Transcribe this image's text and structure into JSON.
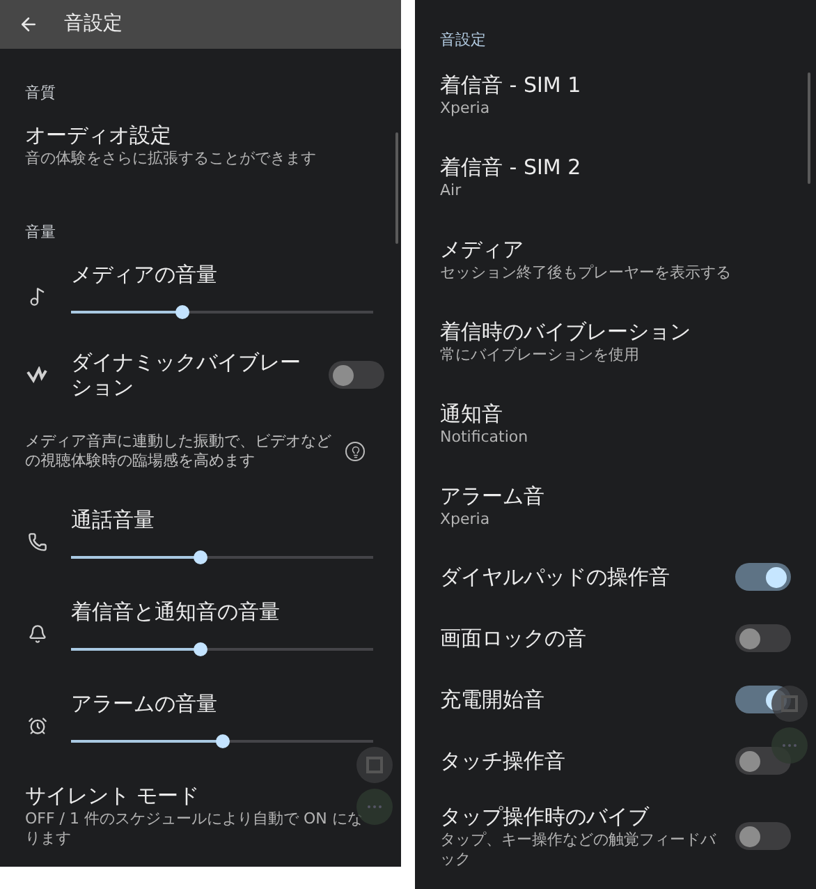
{
  "left": {
    "header": {
      "title": "音設定"
    },
    "items": [
      {
        "kind": "section",
        "title": "音質"
      },
      {
        "kind": "link",
        "title": "オーディオ設定",
        "subtitle": "音の体験をさらに拡張することができます"
      },
      {
        "kind": "section",
        "title": "音量"
      },
      {
        "kind": "slider",
        "title": "メディアの音量",
        "level": 0.37
      },
      {
        "kind": "toggle",
        "title": "ダイナミックバイブレーション",
        "on": false
      },
      {
        "kind": "note",
        "text": "メディア音声に連動した振動で、ビデオなどの視聴体験時の臨場感を高めます"
      },
      {
        "kind": "slider",
        "title": "通話音量",
        "level": 0.43
      },
      {
        "kind": "slider",
        "title": "着信音と通知音の音量",
        "level": 0.43
      },
      {
        "kind": "slider",
        "title": "アラームの音量",
        "level": 0.5
      },
      {
        "kind": "link",
        "title": "サイレント モード",
        "subtitle": "OFF / 1 件のスケジュールにより自動で ON になります"
      }
    ]
  },
  "right": {
    "items": [
      {
        "kind": "section",
        "title": "音設定"
      },
      {
        "kind": "link",
        "title": "着信音 - SIM 1",
        "subtitle": "Xperia"
      },
      {
        "kind": "link",
        "title": "着信音 - SIM 2",
        "subtitle": "Air"
      },
      {
        "kind": "link",
        "title": "メディア",
        "subtitle": "セッション終了後もプレーヤーを表示する"
      },
      {
        "kind": "link",
        "title": "着信時のバイブレーション",
        "subtitle": "常にバイブレーションを使用"
      },
      {
        "kind": "link",
        "title": "通知音",
        "subtitle": "Notification"
      },
      {
        "kind": "link",
        "title": "アラーム音",
        "subtitle": "Xperia"
      },
      {
        "kind": "toggle",
        "title": "ダイヤルパッドの操作音",
        "on": true
      },
      {
        "kind": "toggle",
        "title": "画面ロックの音",
        "on": false
      },
      {
        "kind": "toggle",
        "title": "充電開始音",
        "on": true
      },
      {
        "kind": "toggle",
        "title": "タッチ操作音",
        "on": false
      },
      {
        "kind": "toggle",
        "title": "タップ操作時のバイブ",
        "subtitle": "タップ、キー操作などの触覚フィードバック",
        "on": false
      }
    ]
  }
}
